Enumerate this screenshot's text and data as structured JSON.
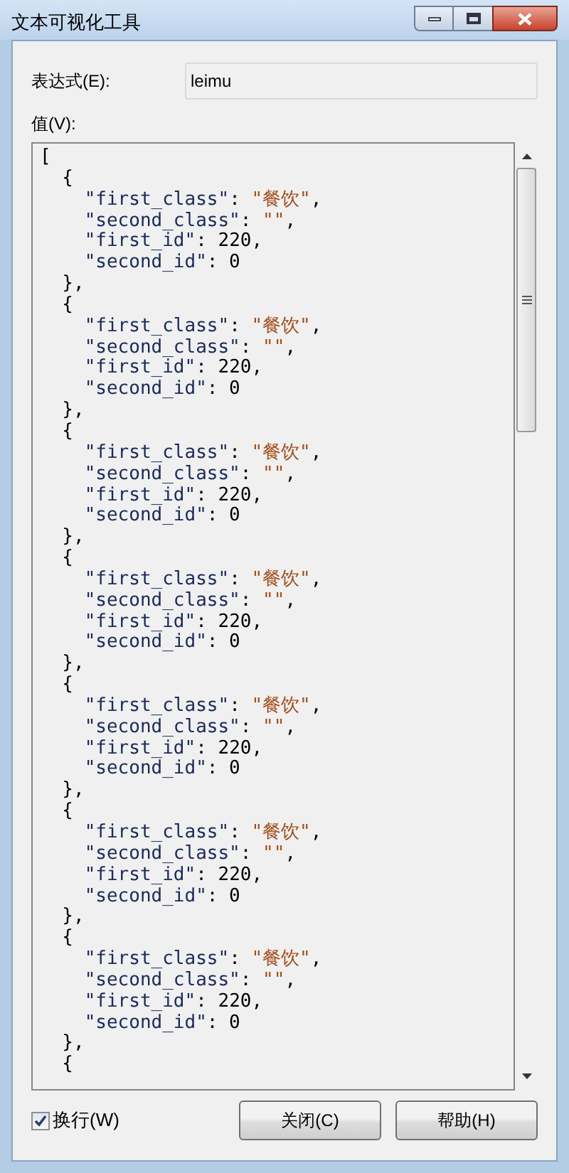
{
  "window": {
    "title": "文本可视化工具"
  },
  "expression": {
    "label": "表达式(E):",
    "value": "leimu"
  },
  "value_label": "值(V):",
  "code_lines": [
    "[",
    "  {",
    "    \"first_class\": \"餐饮\",",
    "    \"second_class\": \"\",",
    "    \"first_id\": 220,",
    "    \"second_id\": 0",
    "  },",
    "  {",
    "    \"first_class\": \"餐饮\",",
    "    \"second_class\": \"\",",
    "    \"first_id\": 220,",
    "    \"second_id\": 0",
    "  },",
    "  {",
    "    \"first_class\": \"餐饮\",",
    "    \"second_class\": \"\",",
    "    \"first_id\": 220,",
    "    \"second_id\": 0",
    "  },",
    "  {",
    "    \"first_class\": \"餐饮\",",
    "    \"second_class\": \"\",",
    "    \"first_id\": 220,",
    "    \"second_id\": 0",
    "  },",
    "  {",
    "    \"first_class\": \"餐饮\",",
    "    \"second_class\": \"\",",
    "    \"first_id\": 220,",
    "    \"second_id\": 0",
    "  },",
    "  {",
    "    \"first_class\": \"餐饮\",",
    "    \"second_class\": \"\",",
    "    \"first_id\": 220,",
    "    \"second_id\": 0",
    "  },",
    "  {",
    "    \"first_class\": \"餐饮\",",
    "    \"second_class\": \"\",",
    "    \"first_id\": 220,",
    "    \"second_id\": 0",
    "  },",
    "  {"
  ],
  "wrap": {
    "label": "换行(W)",
    "checked": true
  },
  "buttons": [
    "关闭(C)",
    "帮助(H)"
  ]
}
